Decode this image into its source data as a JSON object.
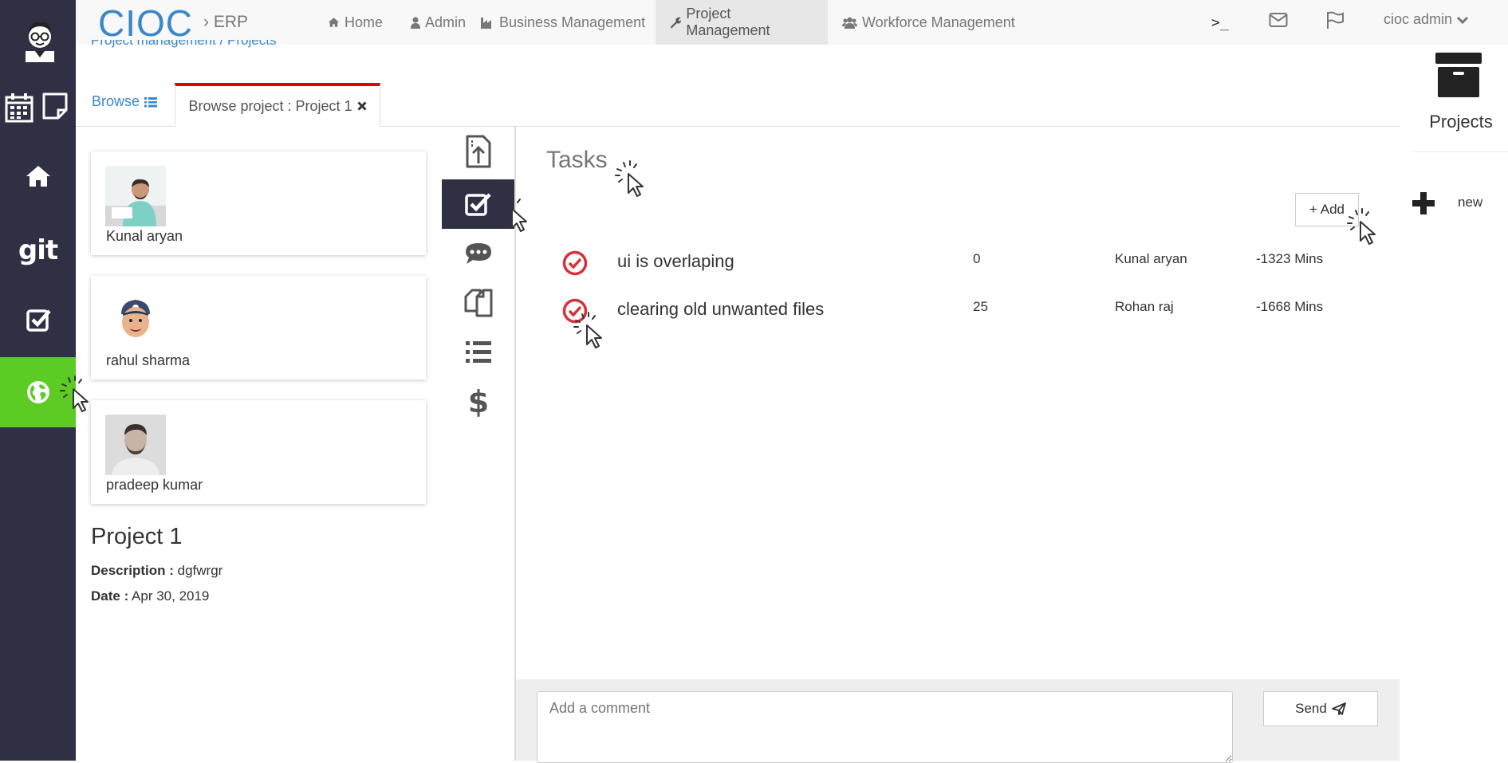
{
  "brand": {
    "name": "CIOC",
    "sub": "ERP"
  },
  "nav": {
    "home": "Home",
    "admin": "Admin",
    "business": "Business Management",
    "project": "Project Management",
    "workforce": "Workforce Management",
    "terminal": ">_",
    "user": "cioc admin"
  },
  "breadcrumb": "Project management / Projects",
  "tabs": {
    "browse": "Browse",
    "project": "Browse project : Project 1"
  },
  "members": [
    {
      "name": "Kunal aryan"
    },
    {
      "name": "rahul sharma"
    },
    {
      "name": "pradeep kumar"
    }
  ],
  "project": {
    "title": "Project 1",
    "description_label": "Description :",
    "description": "dgfwrgr",
    "date_label": "Date :",
    "date": "Apr 30, 2019"
  },
  "tasks": {
    "title": "Tasks",
    "add_label": "+ Add",
    "items": [
      {
        "name": "ui is overlaping",
        "progress": "0",
        "assignee": "Kunal aryan",
        "time": "-1323 Mins"
      },
      {
        "name": "clearing old unwanted files",
        "progress": "25",
        "assignee": "Rohan raj",
        "time": "-1668 Mins"
      }
    ]
  },
  "comment": {
    "placeholder": "Add a comment",
    "send_label": "Send"
  },
  "right_panel": {
    "title": "Projects",
    "new_label": "new"
  },
  "colors": {
    "sidebar": "#2f3044",
    "active_green": "#5ccc24",
    "brand_blue": "#3a87c9",
    "tab_red": "#e30000",
    "check_red": "#d9303a"
  }
}
